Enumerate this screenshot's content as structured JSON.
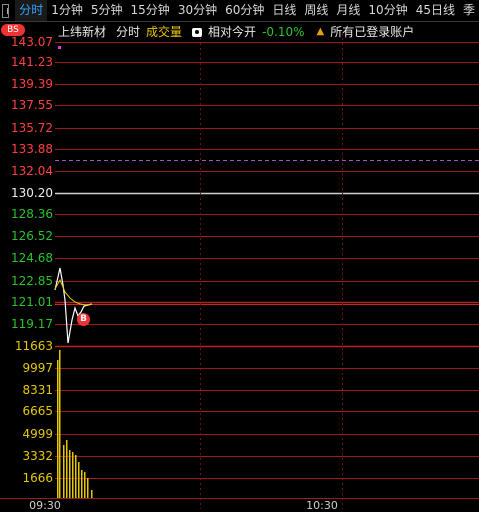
{
  "tabs": [
    "分时",
    "1分钟",
    "5分钟",
    "15分钟",
    "30分钟",
    "60分钟",
    "日线",
    "周线",
    "月线",
    "10分钟",
    "45日线",
    "季"
  ],
  "active_tab": 0,
  "badge": "BS",
  "info": {
    "name": "上纬新材",
    "mode": "分时",
    "volume_label": "成交量",
    "relative_label": "相对今开",
    "relative_pct": "-0.10%",
    "accounts_label": "所有已登录账户"
  },
  "price_axis": [
    {
      "label": "143.07",
      "color": "red"
    },
    {
      "label": "141.23",
      "color": "red"
    },
    {
      "label": "139.39",
      "color": "red"
    },
    {
      "label": "137.55",
      "color": "red"
    },
    {
      "label": "135.72",
      "color": "red"
    },
    {
      "label": "133.88",
      "color": "red"
    },
    {
      "label": "132.04",
      "color": "red"
    },
    {
      "label": "130.20",
      "color": "wht"
    },
    {
      "label": "128.36",
      "color": "grn"
    },
    {
      "label": "126.52",
      "color": "grn"
    },
    {
      "label": "124.68",
      "color": "grn"
    },
    {
      "label": "122.85",
      "color": "grn"
    },
    {
      "label": "121.01",
      "color": "grn"
    },
    {
      "label": "119.17",
      "color": "grn"
    }
  ],
  "volume_axis": [
    "11663",
    "9997",
    "8331",
    "6665",
    "4999",
    "3332",
    "1666"
  ],
  "marker": "B",
  "time_labels": [
    "09:30",
    "10:30"
  ]
}
